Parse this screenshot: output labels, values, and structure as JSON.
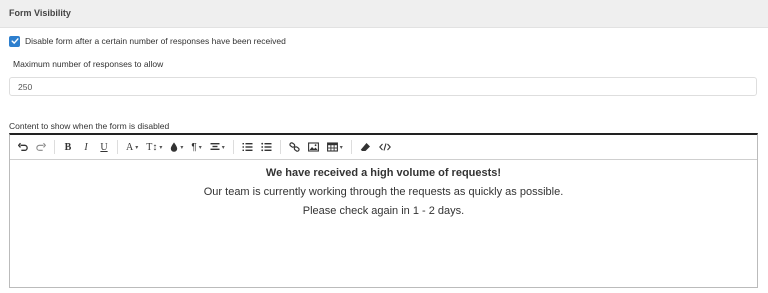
{
  "panel": {
    "title": "Form Visibility"
  },
  "disable_option": {
    "checked": true,
    "label": "Disable form after a certain number of responses have been received"
  },
  "max_responses": {
    "label": "Maximum number of responses to allow",
    "value": "250"
  },
  "disabled_content": {
    "label": "Content to show when the form is disabled"
  },
  "toolbar": {
    "font_size_label": "A",
    "text_style_label": "T↕"
  },
  "editor": {
    "heading": "We have received a high volume of requests!",
    "line1": "Our team is currently working through the requests as quickly as possible.",
    "line2": "Please check again in 1 - 2 days."
  },
  "colors": {
    "accent": "#2d7fce",
    "header_bg": "#efefef"
  }
}
